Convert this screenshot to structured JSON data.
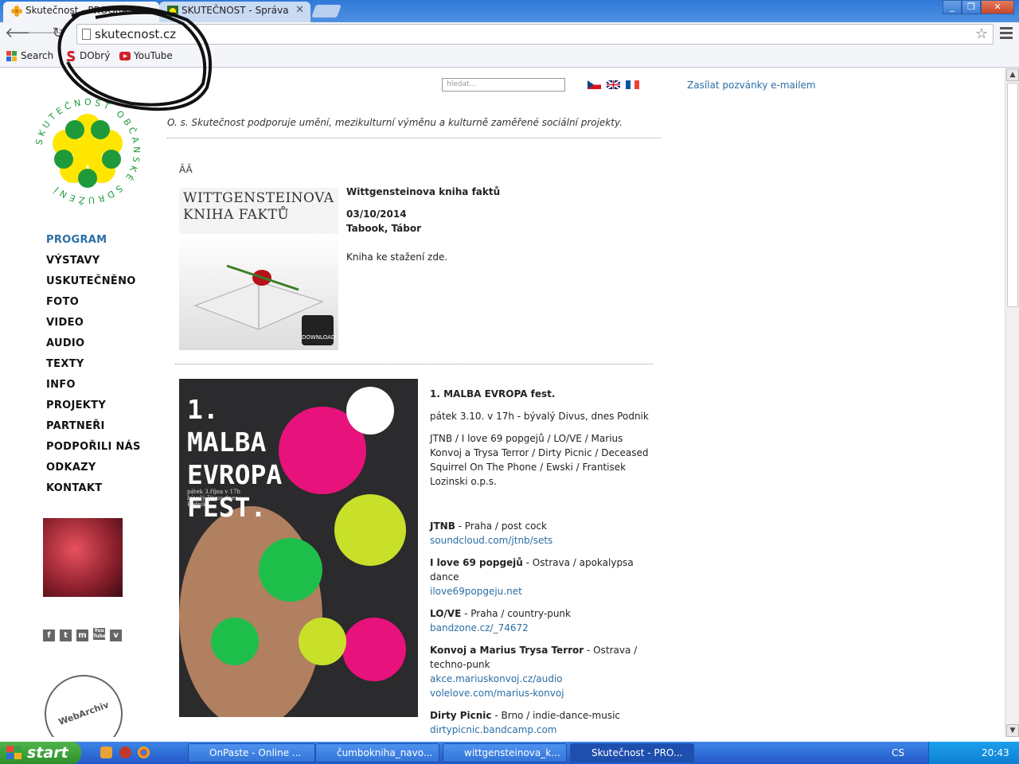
{
  "browser": {
    "tabs": [
      {
        "title": "Skutečnost - PROGRAM"
      },
      {
        "title": "SKUTEČNOST - Správa"
      }
    ],
    "url": "skutecnost.cz",
    "bookmarks": [
      {
        "label": "Search"
      },
      {
        "label": "DObrý"
      },
      {
        "label": "YouTube"
      }
    ]
  },
  "site": {
    "search_placeholder": "hledat...",
    "invite_link": "Zasílat pozvánky e-mailem",
    "tagline": "O. s. Skutečnost podporuje umění, mezikulturní výměnu a kulturně zaměřené sociální projekty.",
    "logo_text": "SKUTEČNOST OBČANSKÉ SDRUŽENÍ",
    "nav": [
      "PROGRAM",
      "VÝSTAVY",
      "USKUTEČNĚNO",
      "FOTO",
      "VIDEO",
      "AUDIO",
      "TEXTY",
      "INFO",
      "PROJEKTY",
      "PARTNEŘI",
      "PODPOŘILI NÁS",
      "ODKAZY",
      "KONTAKT"
    ],
    "social": [
      "f",
      "t",
      "m",
      "You Tube",
      "v"
    ],
    "webarchiv": "WebArchiv"
  },
  "entry1": {
    "stray": "ÂÂ",
    "image_title_line1": "WITTGENSTEINOVA",
    "image_title_line2": "KNIHA FAKTŮ",
    "download_label": "DOWNLOAD",
    "title": "Wittgensteinova kniha faktů",
    "date": "03/10/2014",
    "venue": "Tabook, Tábor",
    "note": "Kniha ke stažení zde."
  },
  "entry2": {
    "poster_title": "1. MALBA EVROPA FEST.",
    "poster_sub": "pátek 3.října v 17h bývalý Divus dnes Podnik",
    "title": "1. MALBA EVROPA fest.",
    "when": "pátek 3.10. v 17h - bývalý Divus, dnes Podnik",
    "lineup": "JTNB  / I love 69 popgejů / LO/VE / Marius Konvoj a Trysa Terror / Dirty Picnic / Deceased Squirrel On The Phone / Ewski / Frantisek Lozinski o.p.s.",
    "acts": [
      {
        "name": "JTNB",
        "desc": " - Praha / post cock",
        "links": [
          "soundcloud.com/jtnb/sets"
        ]
      },
      {
        "name": "I love 69 popgejů",
        "desc": " - Ostrava / apokalypsa dance",
        "links": [
          "ilove69popgeju.net"
        ]
      },
      {
        "name": "LO/VE",
        "desc": " - Praha / country-punk",
        "links": [
          "bandzone.cz/_74672"
        ]
      },
      {
        "name": "Konvoj a Marius Trysa Terror",
        "desc": " - Ostrava / techno-punk",
        "links": [
          "akce.mariuskonvoj.cz/audio",
          "volelove.com/marius-konvoj"
        ]
      },
      {
        "name": "Dirty Picnic",
        "desc": " - Brno / indie-dance-music",
        "links": [
          "dirtypicnic.bandcamp.com"
        ]
      }
    ]
  },
  "taskbar": {
    "start": "start",
    "windows": [
      "OnPaste - Online ...",
      "čumbokniha_navo...",
      "wittgensteinova_k...",
      "Skutečnost - PRO..."
    ],
    "lang": "CS",
    "time": "20:43"
  },
  "colors": {
    "accent": "#2a6ea6",
    "logo_yellow": "#ffe600",
    "logo_green": "#1f9a3a"
  }
}
